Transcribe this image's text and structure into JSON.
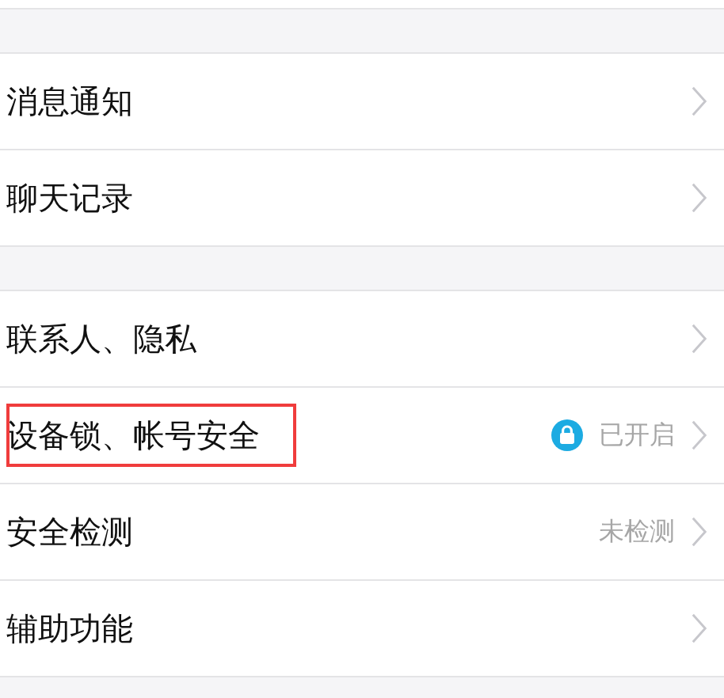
{
  "groups": [
    {
      "items": [
        {
          "label": "消息通知",
          "kind": "plain",
          "highlighted": false
        },
        {
          "label": "聊天记录",
          "kind": "plain",
          "highlighted": false
        }
      ]
    },
    {
      "items": [
        {
          "label": "联系人、隐私",
          "kind": "plain",
          "highlighted": false
        },
        {
          "label": "设备锁、帐号安全",
          "kind": "locked",
          "status": "已开启",
          "highlighted": true
        },
        {
          "label": "安全检测",
          "kind": "status",
          "status": "未检测",
          "highlighted": false
        },
        {
          "label": "辅助功能",
          "kind": "plain",
          "highlighted": false
        }
      ]
    }
  ]
}
